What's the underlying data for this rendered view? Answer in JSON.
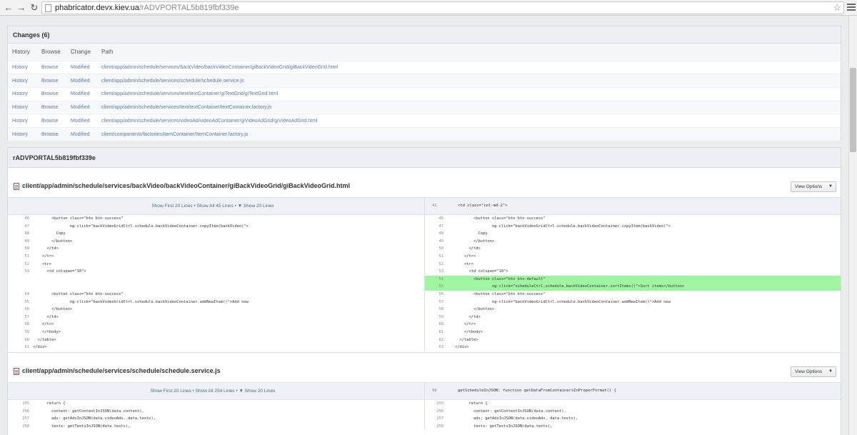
{
  "browser": {
    "url_host": "phabricator.devx.kiev.ua",
    "url_path": "/rADVPORTAL5b819fbf339e"
  },
  "changes": {
    "title": "Changes (6)",
    "columns": [
      "History",
      "Browse",
      "Change",
      "Path"
    ],
    "rows": [
      [
        "History",
        "Browse",
        "Modified",
        "client/app/admin/schedule/services/backVideo/backVideoContainer/giBackVideoGrid/giBackVideoGrid.html"
      ],
      [
        "History",
        "Browse",
        "Modified",
        "client/app/admin/schedule/services/schedule/schedule.service.js"
      ],
      [
        "History",
        "Browse",
        "Modified",
        "client/app/admin/schedule/services/text/textContainer/giTextGrid/giTextGrid.html"
      ],
      [
        "History",
        "Browse",
        "Modified",
        "client/app/admin/schedule/services/text/textContainer/textContainer.factory.js"
      ],
      [
        "History",
        "Browse",
        "Modified",
        "client/app/admin/schedule/services/videoAd/videoAdContainer/giVideoAdGrid/giVideoAdGrid.html"
      ],
      [
        "History",
        "Browse",
        "Modified",
        "client/components/factories/itemContainer/ItemContainer.factory.js"
      ]
    ]
  },
  "commit": {
    "title": "rADVPORTAL5b819fbf339e"
  },
  "files": [
    {
      "path": "client/app/admin/schedule/services/backVideo/backVideoContainer/giBackVideoGrid/giBackVideoGrid.html",
      "view_options": "View Options",
      "show_links": "Show First 20 Lines • Show All 45 Lines • ▼ Show 20 Lines",
      "context_right_num": "41",
      "context_right_text": "<td class=\"col-md-2\">",
      "lines": [
        {
          "ln": "46",
          "l": "        <button class=\"btn btn-success\"",
          "rn": "46",
          "r": "        <button class=\"btn btn-success\"",
          "added": false
        },
        {
          "ln": "47",
          "l": "                ng-click=\"backVideoGridCtrl.schedule.backVideoContainer.copyItem(backVideo)\">",
          "rn": "47",
          "r": "                ng-click=\"backVideoGridCtrl.schedule.backVideoContainer.copyItem(backVideo)\">",
          "added": false
        },
        {
          "ln": "48",
          "l": "          Copy",
          "rn": "48",
          "r": "          Copy",
          "added": false
        },
        {
          "ln": "49",
          "l": "        </button>",
          "rn": "49",
          "r": "        </button>",
          "added": false
        },
        {
          "ln": "50",
          "l": "      </td>",
          "rn": "50",
          "r": "      </td>",
          "added": false
        },
        {
          "ln": "51",
          "l": "    </tr>",
          "rn": "51",
          "r": "    </tr>",
          "added": false
        },
        {
          "ln": "52",
          "l": "    <tr>",
          "rn": "52",
          "r": "    <tr>",
          "added": false
        },
        {
          "ln": "53",
          "l": "      <td colspan=\"10\">",
          "rn": "53",
          "r": "      <td colspan=\"10\">",
          "added": false
        },
        {
          "ln": "",
          "l": "",
          "rn": "54",
          "r": "        <button class=\"btn btn-default\"",
          "added": true
        },
        {
          "ln": "",
          "l": "",
          "rn": "55",
          "r": "                ng-click=\"scheduleCtrl.schedule.backVideoContainer.sortItems()\">Sort items</button>",
          "added": true
        },
        {
          "ln": "54",
          "l": "        <button class=\"btn btn-success\"",
          "rn": "56",
          "r": "        <button class=\"btn btn-success\"",
          "added": false
        },
        {
          "ln": "55",
          "l": "                ng-click=\"backVideoGridCtrl.schedule.backVideoContainer.addNewItem()\">Add new",
          "rn": "57",
          "r": "                ng-click=\"backVideoGridCtrl.schedule.backVideoContainer.addNewItem()\">Add new",
          "added": false
        },
        {
          "ln": "56",
          "l": "        </button>",
          "rn": "58",
          "r": "        </button>",
          "added": false
        },
        {
          "ln": "57",
          "l": "      </td>",
          "rn": "59",
          "r": "      </td>",
          "added": false
        },
        {
          "ln": "58",
          "l": "    </tr>",
          "rn": "60",
          "r": "    </tr>",
          "added": false
        },
        {
          "ln": "59",
          "l": "    </tbody>",
          "rn": "61",
          "r": "    </tbody>",
          "added": false
        },
        {
          "ln": "60",
          "l": "  </table>",
          "rn": "62",
          "r": "  </table>",
          "added": false
        },
        {
          "ln": "61",
          "l": "</div>",
          "rn": "63",
          "r": "</div>",
          "added": false
        }
      ]
    },
    {
      "path": "client/app/admin/schedule/services/schedule/schedule.service.js",
      "view_options": "View Options",
      "show_links": "Show First 20 Lines • Show All 254 Lines • ▼ Show 20 Lines",
      "context_right_num": "98",
      "context_right_text": "getScheduleInJSON: function getDataFromContainersInProperFormat() {",
      "lines": [
        {
          "ln": "255",
          "l": "      return {",
          "rn": "255",
          "r": "      return {",
          "added": false
        },
        {
          "ln": "256",
          "l": "        content: getContentInJSON(data.content),",
          "rn": "256",
          "r": "        content: getContentInJSON(data.content),",
          "added": false
        },
        {
          "ln": "257",
          "l": "        ads: getAdsInJSON(data.videoAds, data.texts),",
          "rn": "257",
          "r": "        ads: getAdsInJSON(data.videoAds, data.texts),",
          "added": false
        },
        {
          "ln": "258",
          "l": "        texts: getTextsInJSON(data.texts),",
          "rn": "258",
          "r": "        texts: getTextsInJSON(data.texts),",
          "added": false
        }
      ]
    }
  ]
}
